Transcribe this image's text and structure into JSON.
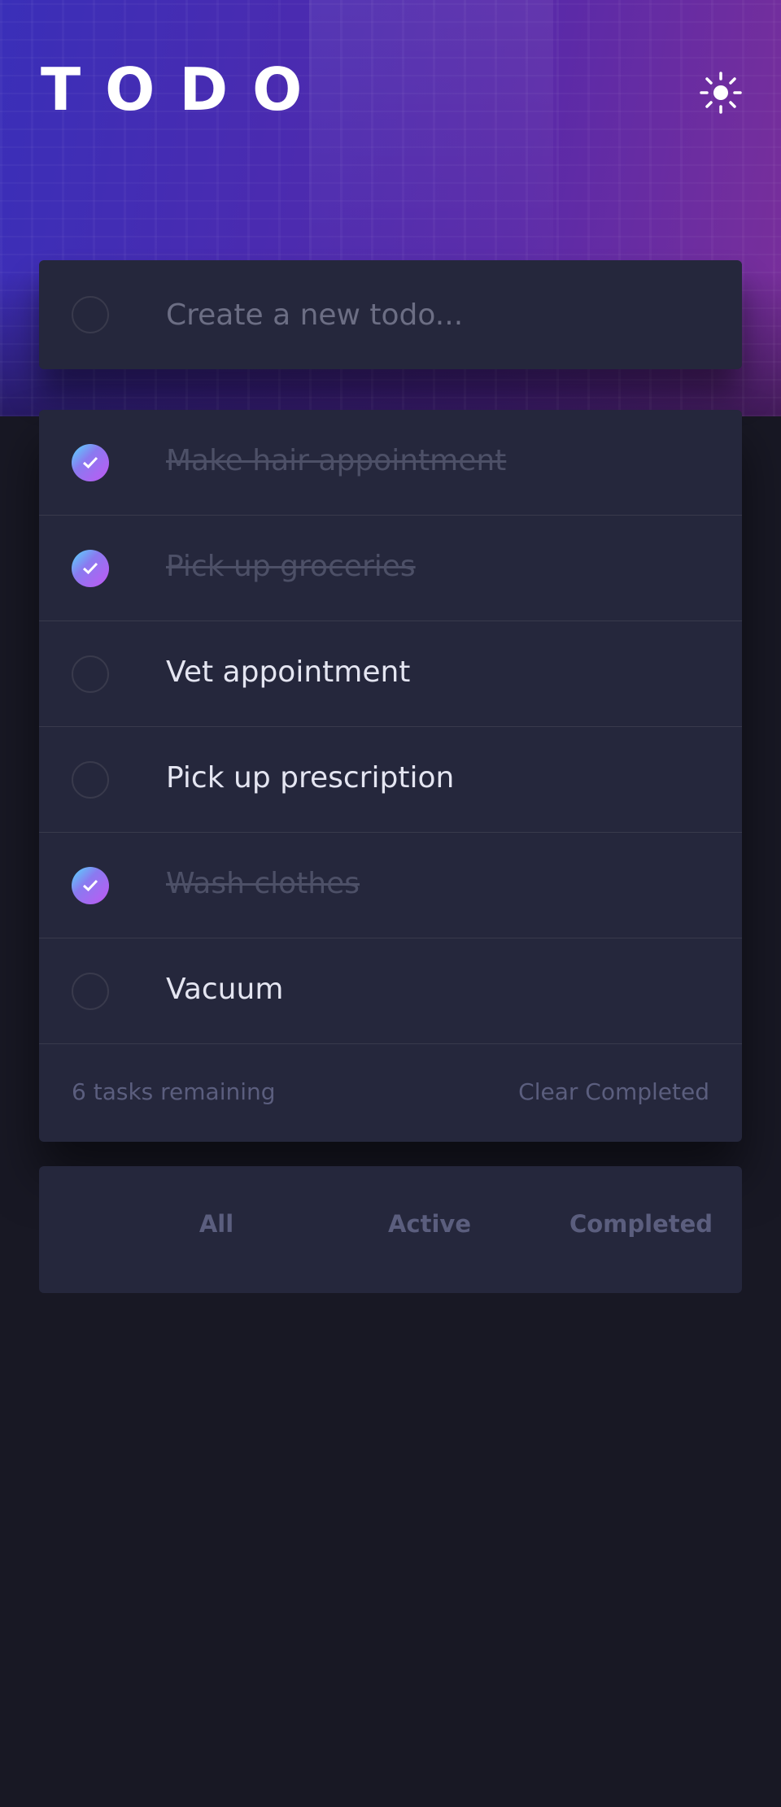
{
  "app": {
    "title": "TODO",
    "theme_toggle_icon": "sun-icon"
  },
  "new_todo": {
    "placeholder": "Create a new todo...",
    "value": ""
  },
  "todos": [
    {
      "label": "Make hair appointment",
      "completed": true
    },
    {
      "label": "Pick up groceries",
      "completed": true
    },
    {
      "label": "Vet appointment",
      "completed": false
    },
    {
      "label": "Pick up prescription",
      "completed": false
    },
    {
      "label": "Wash clothes",
      "completed": true
    },
    {
      "label": "Vacuum",
      "completed": false
    }
  ],
  "footer": {
    "remaining_text": "6 tasks remaining",
    "clear_label": "Clear Completed"
  },
  "filters": {
    "all": "All",
    "active": "Active",
    "completed": "Completed",
    "selected": null
  },
  "colors": {
    "background": "#181824",
    "card": "#25273c",
    "check_gradient_start": "#55ddff",
    "check_gradient_end": "#c058f3"
  }
}
